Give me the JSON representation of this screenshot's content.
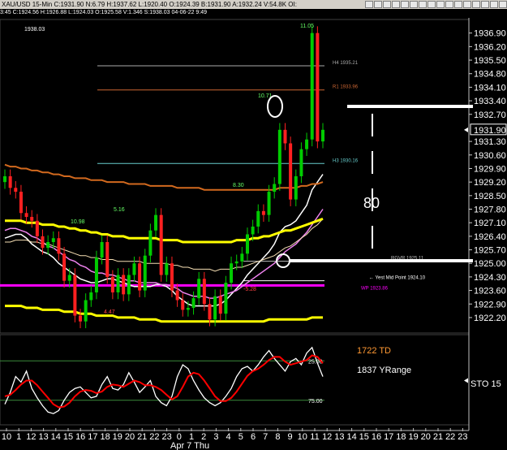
{
  "header": {
    "title": "XAU/USD  15-Min  C:1931.90  N:6.79  H:1937.62  L:1920.40  O:1924.39  B:1931.90  A:1932.24  V:54.8K  OI:",
    "subline": "3:45  C:1924.56  H:1926.88  L:1924.03  O:1925.58  V:1.346  S:1938.03  04-06-22  9:49",
    "icons": [
      "window-icon",
      "box-icon",
      "zoom-icon",
      "fit-icon",
      "draw-icon",
      "pencil-icon",
      "text-icon",
      "cursor-icon",
      "trend-icon",
      "hline-icon",
      "vline-icon",
      "cross-icon",
      "arrow-icon",
      "minus-icon",
      "plus-icon",
      "close-icon"
    ]
  },
  "colors": {
    "background": "#000000",
    "up_bar": "#00cc00",
    "down_bar": "#ff2020",
    "ma_orange": "#d2691e",
    "ma_yellow": "#ffff00",
    "ma_white": "#ffffff",
    "ma_violet": "#ee82ee",
    "pivot_magenta": "#ff00ff",
    "stoch_white": "#ffffff",
    "stoch_red": "#ff0000"
  },
  "chart_data": [
    {
      "type": "candlestick",
      "title": "XAU/USD 15-Min",
      "current_price_label": "1931.90",
      "high_marker_label": "1938.03",
      "yaxis_ticks": [
        "1936.90",
        "1936.20",
        "1935.50",
        "1934.80",
        "1934.10",
        "1933.40",
        "1932.70",
        "1931.30",
        "1930.60",
        "1929.90",
        "1929.20",
        "1928.50",
        "1927.80",
        "1927.10",
        "1926.40",
        "1925.70",
        "1925.00",
        "1924.30",
        "1923.60",
        "1922.90",
        "1922.20"
      ],
      "ylim": [
        1921.4,
        1937.6
      ],
      "levels": [
        {
          "label": "H4 1935.21",
          "value": 1935.21
        },
        {
          "label": "R1 1933.96",
          "value": 1933.96
        },
        {
          "label": "H3 1930.16",
          "value": 1930.16
        },
        {
          "label": "RGVR 1925.11",
          "value": 1925.11
        },
        {
          "label": "Yest Mid Point 1924.10",
          "value": 1924.1
        },
        {
          "label": "WP 1923.86",
          "value": 1923.86
        }
      ],
      "annotations": [
        "11.05",
        "10.71",
        "8.30",
        "5.16",
        "10.98",
        "-5.28",
        "4.47",
        "80"
      ],
      "series": [
        {
          "values": [
            1929.5,
            1928.9,
            1928.7,
            1927.6,
            1927.4,
            1927.2,
            1926.4,
            1925.8,
            1926.1,
            1926.3,
            1925.5,
            1924.1,
            1924.4,
            1922.3,
            1922.0,
            1923.1,
            1923.5,
            1925.3,
            1926.1,
            1924.3,
            1923.5,
            1924.4,
            1923.4,
            1924.4,
            1925.0,
            1923.6,
            1925.4,
            1926.7,
            1927.5,
            1924.4,
            1925.0,
            1923.6,
            1923.1,
            1922.6,
            1922.7,
            1923.2,
            1924.2,
            1922.9,
            1922.1,
            1923.3,
            1922.4,
            1924.0,
            1925.0,
            1925.1,
            1925.5,
            1926.5,
            1926.9,
            1927.7,
            1927.5,
            1928.7,
            1929.1,
            1931.9,
            1931.2,
            1928.3,
            1929.5,
            1930.9,
            1931.4,
            1936.9,
            1931.3,
            1931.9
          ]
        }
      ],
      "ma_series": [
        {
          "values": [
            1926.3,
            1926.4,
            1926.5,
            1926.5,
            1926.3,
            1926.0,
            1925.8,
            1925.6,
            1925.5,
            1925.3,
            1925.0,
            1924.8,
            1924.6,
            1924.4,
            1924.2,
            1924.1,
            1924.0,
            1924.0,
            1924.1,
            1924.2,
            1924.2,
            1924.1,
            1924.0,
            1923.9,
            1923.8,
            1923.8,
            1923.8,
            1923.8,
            1923.9,
            1923.9,
            1923.8,
            1923.6,
            1923.3,
            1923.1,
            1922.9,
            1922.8,
            1922.8,
            1922.8,
            1922.8,
            1922.8,
            1922.9,
            1923.1,
            1923.4,
            1923.7,
            1924.0,
            1924.4,
            1924.7,
            1925.0,
            1925.3,
            1925.6,
            1926.0,
            1926.6,
            1926.9,
            1927.0,
            1927.2,
            1927.6,
            1928.0,
            1928.8,
            1929.2,
            1929.6
          ]
        },
        {
          "values": [
            1926.7,
            1926.8,
            1926.8,
            1926.7,
            1926.6,
            1926.4,
            1926.3,
            1926.1,
            1925.9,
            1925.8,
            1925.6,
            1925.4,
            1925.2,
            1925.1,
            1924.9,
            1924.8,
            1924.6,
            1924.5,
            1924.5,
            1924.4,
            1924.4,
            1924.3,
            1924.2,
            1924.1,
            1924.1,
            1924.0,
            1924.0,
            1924.0,
            1924.0,
            1923.9,
            1923.9,
            1923.8,
            1923.7,
            1923.5,
            1923.4,
            1923.3,
            1923.3,
            1923.3,
            1923.2,
            1923.2,
            1923.3,
            1923.4,
            1923.5,
            1923.6,
            1923.8,
            1924.0,
            1924.2,
            1924.4,
            1924.6,
            1924.8,
            1925.0,
            1925.3,
            1925.6,
            1925.8,
            1926.0,
            1926.3,
            1926.6,
            1927.0,
            1927.4,
            1927.8
          ]
        },
        {
          "values": [
            1926.1,
            1926.1,
            1926.2,
            1926.2,
            1926.2,
            1926.1,
            1926.1,
            1926.0,
            1926.0,
            1925.9,
            1925.8,
            1925.7,
            1925.6,
            1925.5,
            1925.4,
            1925.4,
            1925.3,
            1925.3,
            1925.2,
            1925.2,
            1925.2,
            1925.1,
            1925.1,
            1925.1,
            1925.1,
            1925.1,
            1925.0,
            1925.0,
            1925.0,
            1925.0,
            1925.0,
            1924.9,
            1924.9,
            1924.8,
            1924.8,
            1924.7,
            1924.7,
            1924.7,
            1924.7,
            1924.6,
            1924.7,
            1924.7,
            1924.7,
            1924.8,
            1924.8,
            1924.9,
            1925.0,
            1925.1,
            1925.2,
            1925.3,
            1925.4,
            1925.6,
            1925.8,
            1925.9,
            1926.1,
            1926.3,
            1926.5,
            1926.8,
            1927.0,
            1927.3
          ]
        },
        {
          "values": [
            1927.2,
            1927.2,
            1927.2,
            1927.2,
            1927.1,
            1927.1,
            1927.1,
            1927.0,
            1927.0,
            1927.0,
            1926.9,
            1926.9,
            1926.8,
            1926.8,
            1926.7,
            1926.7,
            1926.6,
            1926.6,
            1926.5,
            1926.5,
            1926.4,
            1926.4,
            1926.4,
            1926.3,
            1926.3,
            1926.3,
            1926.3,
            1926.3,
            1926.3,
            1926.2,
            1926.2,
            1926.2,
            1926.2,
            1926.1,
            1926.1,
            1926.1,
            1926.1,
            1926.1,
            1926.1,
            1926.1,
            1926.1,
            1926.1,
            1926.1,
            1926.2,
            1926.2,
            1926.2,
            1926.3,
            1926.3,
            1926.4,
            1926.4,
            1926.5,
            1926.6,
            1926.7,
            1926.7,
            1926.8,
            1926.9,
            1927.0,
            1927.1,
            1927.2,
            1927.3
          ]
        },
        {
          "values": [
            1930.1,
            1930.0,
            1930.0,
            1929.9,
            1929.9,
            1929.8,
            1929.8,
            1929.7,
            1929.7,
            1929.6,
            1929.6,
            1929.5,
            1929.5,
            1929.4,
            1929.4,
            1929.4,
            1929.3,
            1929.3,
            1929.3,
            1929.2,
            1929.2,
            1929.2,
            1929.2,
            1929.1,
            1929.1,
            1929.1,
            1929.1,
            1929.0,
            1929.0,
            1929.0,
            1929.0,
            1929.0,
            1928.9,
            1928.9,
            1928.9,
            1928.9,
            1928.9,
            1928.8,
            1928.8,
            1928.8,
            1928.8,
            1928.8,
            1928.8,
            1928.8,
            1928.8,
            1928.8,
            1928.8,
            1928.8,
            1928.8,
            1928.8,
            1928.8,
            1928.9,
            1928.9,
            1928.9,
            1928.9,
            1929.0,
            1929.0,
            1929.1,
            1929.1,
            1929.2
          ]
        },
        {
          "values": [
            1922.8,
            1922.8,
            1922.8,
            1922.8,
            1922.7,
            1922.7,
            1922.7,
            1922.6,
            1922.6,
            1922.6,
            1922.6,
            1922.5,
            1922.5,
            1922.5,
            1922.4,
            1922.4,
            1922.4,
            1922.3,
            1922.3,
            1922.3,
            1922.3,
            1922.2,
            1922.2,
            1922.2,
            1922.2,
            1922.1,
            1922.1,
            1922.1,
            1922.1,
            1922.0,
            1922.0,
            1922.0,
            1922.0,
            1922.0,
            1922.0,
            1922.0,
            1922.0,
            1922.0,
            1922.0,
            1922.0,
            1922.0,
            1922.0,
            1922.0,
            1922.0,
            1922.0,
            1922.0,
            1922.0,
            1922.0,
            1922.0,
            1922.1,
            1922.1,
            1922.1,
            1922.1,
            1922.1,
            1922.1,
            1922.1,
            1922.1,
            1922.2,
            1922.2,
            1922.2
          ]
        }
      ]
    },
    {
      "type": "line",
      "title": "STO 15",
      "legend": [
        "1722 TD",
        "1837 YRange"
      ],
      "yaxis_ticks": [
        "25.00",
        "75.00"
      ],
      "right_label": "STO 15",
      "ylim": [
        0,
        100
      ],
      "series": [
        {
          "values": [
            20,
            35,
            55,
            48,
            62,
            40,
            28,
            18,
            10,
            8,
            12,
            25,
            35,
            40,
            42,
            35,
            28,
            30,
            45,
            55,
            40,
            38,
            45,
            60,
            48,
            35,
            42,
            50,
            30,
            22,
            18,
            30,
            55,
            70,
            65,
            50,
            38,
            28,
            22,
            18,
            22,
            30,
            40,
            55,
            65,
            68,
            62,
            70,
            80,
            88,
            78,
            70,
            62,
            74,
            78,
            70,
            85,
            92,
            72,
            55
          ]
        },
        {
          "values": [
            30,
            32,
            38,
            45,
            50,
            50,
            44,
            36,
            28,
            20,
            16,
            17,
            22,
            30,
            36,
            38,
            37,
            34,
            36,
            42,
            45,
            44,
            42,
            46,
            50,
            48,
            44,
            44,
            42,
            38,
            32,
            26,
            30,
            42,
            55,
            60,
            58,
            50,
            40,
            30,
            24,
            24,
            28,
            36,
            46,
            56,
            62,
            65,
            70,
            76,
            80,
            80,
            74,
            70,
            72,
            74,
            76,
            82,
            80,
            72
          ]
        }
      ]
    }
  ],
  "xaxis": {
    "ticks": [
      "10",
      "1",
      "12",
      "13",
      "14",
      "15",
      "16",
      "17",
      "18",
      "19",
      "20",
      "21",
      "22",
      "23",
      "0",
      "1",
      "2",
      "3",
      "4",
      "5",
      "6",
      "7",
      "8",
      "9",
      "10",
      "11",
      "12",
      "13",
      "14",
      "15",
      "16",
      "17",
      "18",
      "19",
      "20",
      "21",
      "22",
      "23"
    ],
    "date_label": "Apr 7 Thu"
  }
}
